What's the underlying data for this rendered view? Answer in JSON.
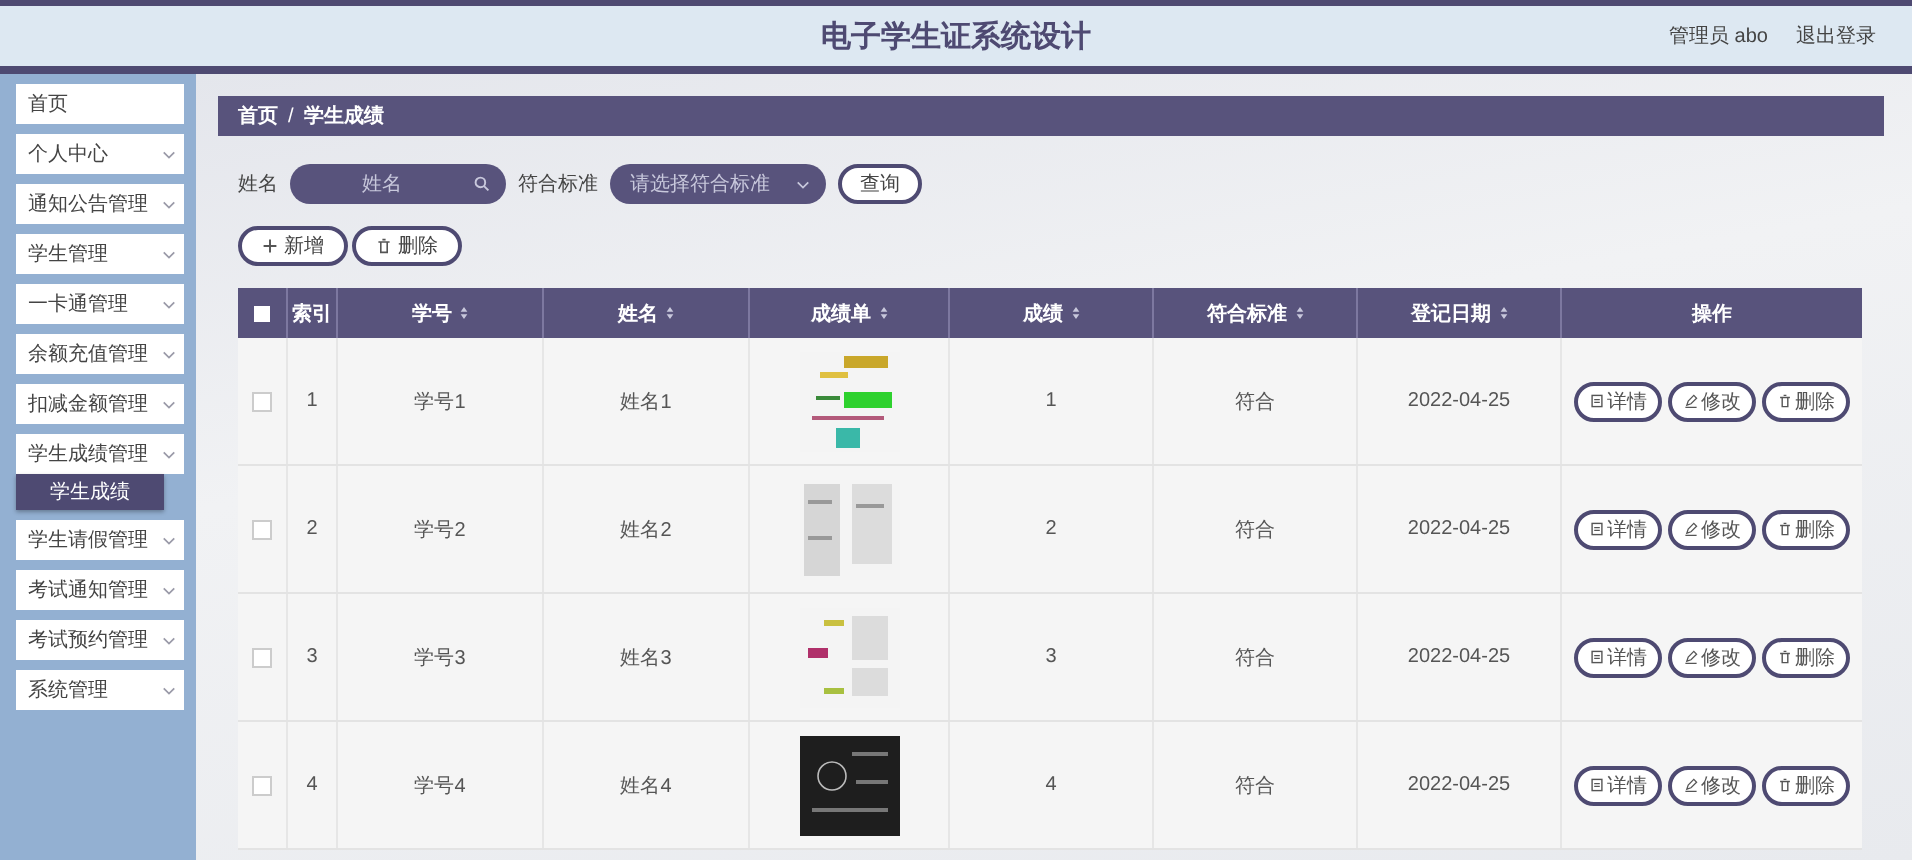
{
  "header": {
    "title": "电子学生证系统设计",
    "user": "管理员 abo",
    "logout": "退出登录"
  },
  "sidebar": {
    "items": [
      {
        "label": "首页",
        "kind": "link"
      },
      {
        "label": "个人中心",
        "kind": "menu"
      },
      {
        "label": "通知公告管理",
        "kind": "menu"
      },
      {
        "label": "学生管理",
        "kind": "menu"
      },
      {
        "label": "一卡通管理",
        "kind": "menu"
      },
      {
        "label": "余额充值管理",
        "kind": "menu"
      },
      {
        "label": "扣减金额管理",
        "kind": "menu"
      },
      {
        "label": "学生成绩管理",
        "kind": "menu",
        "children": [
          {
            "label": "学生成绩",
            "selected": true
          }
        ]
      },
      {
        "label": "学生请假管理",
        "kind": "menu"
      },
      {
        "label": "考试通知管理",
        "kind": "menu"
      },
      {
        "label": "考试预约管理",
        "kind": "menu"
      },
      {
        "label": "系统管理",
        "kind": "menu"
      }
    ]
  },
  "breadcrumb": [
    "首页",
    "学生成绩"
  ],
  "breadcrumb_separator": "/",
  "search": {
    "name_label": "姓名",
    "name_placeholder": "姓名",
    "standard_label": "符合标准",
    "standard_placeholder": "请选择符合标准",
    "query_button": "查询"
  },
  "actions": [
    {
      "label": "新增"
    },
    {
      "label": "删除"
    }
  ],
  "table": {
    "select_all": {
      "checked": false
    },
    "columns": [
      {
        "label": "索引",
        "sortable": false
      },
      {
        "label": "学号",
        "sortable": true
      },
      {
        "label": "姓名",
        "sortable": true
      },
      {
        "label": "成绩单",
        "sortable": true
      },
      {
        "label": "成绩",
        "sortable": true
      },
      {
        "label": "符合标准",
        "sortable": true
      },
      {
        "label": "登记日期",
        "sortable": true
      },
      {
        "label": "操作",
        "sortable": false
      }
    ],
    "rows": [
      {
        "checked": false,
        "index": "1",
        "student_no": "学号1",
        "name": "姓名1",
        "transcript": {
          "kind": "picture"
        },
        "score": "1",
        "standard": "符合",
        "date": "2022-04-25",
        "buttons": [
          "详情",
          "修改",
          "删除"
        ]
      },
      {
        "checked": false,
        "index": "2",
        "student_no": "学号2",
        "name": "姓名2",
        "transcript": {
          "kind": "picture"
        },
        "score": "2",
        "standard": "符合",
        "date": "2022-04-25",
        "buttons": [
          "详情",
          "修改",
          "删除"
        ]
      },
      {
        "checked": false,
        "index": "3",
        "student_no": "学号3",
        "name": "姓名3",
        "transcript": {
          "kind": "picture"
        },
        "score": "3",
        "standard": "符合",
        "date": "2022-04-25",
        "buttons": [
          "详情",
          "修改",
          "删除"
        ]
      },
      {
        "checked": false,
        "index": "4",
        "student_no": "学号4",
        "name": "姓名4",
        "transcript": {
          "kind": "picture"
        },
        "score": "4",
        "standard": "符合",
        "date": "2022-04-25",
        "buttons": [
          "详情",
          "修改",
          "删除"
        ]
      }
    ]
  }
}
